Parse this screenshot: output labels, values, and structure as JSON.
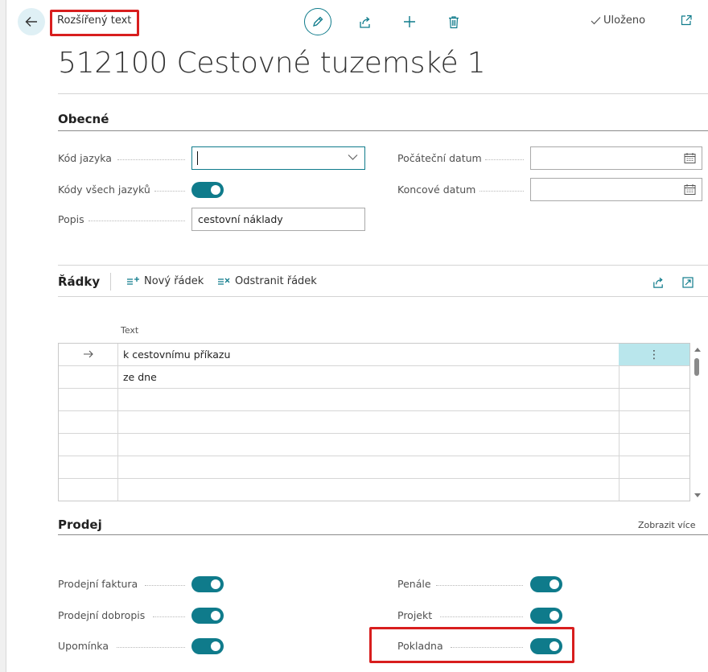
{
  "header": {
    "breadcrumb": "Rozšířený text",
    "status": "Uloženo",
    "title": "512100 Cestovné tuzemské 1"
  },
  "toolbar": {
    "icons": [
      "pencil-icon",
      "share-icon",
      "plus-icon",
      "trash-icon"
    ]
  },
  "general": {
    "section_title": "Obecné",
    "language_code_label": "Kód jazyka",
    "language_code_value": "",
    "all_languages_label": "Kódy všech jazyků",
    "all_languages_on": true,
    "description_label": "Popis",
    "description_value": "cestovní náklady",
    "start_date_label": "Počáteční datum",
    "start_date_value": "",
    "end_date_label": "Koncové datum",
    "end_date_value": ""
  },
  "lines": {
    "section_title": "Řádky",
    "new_line_label": "Nový řádek",
    "delete_line_label": "Odstranit řádek",
    "column_text": "Text",
    "rows": [
      "k cestovnímu příkazu",
      "ze dne",
      "",
      "",
      "",
      "",
      ""
    ]
  },
  "sales": {
    "section_title": "Prodej",
    "show_more": "Zobrazit více",
    "sales_invoice_label": "Prodejní faktura",
    "sales_invoice_on": true,
    "sales_credit_memo_label": "Prodejní dobropis",
    "sales_credit_memo_on": true,
    "reminder_label": "Upomínka",
    "reminder_on": true,
    "penalty_label": "Penále",
    "penalty_on": true,
    "project_label": "Projekt",
    "project_on": true,
    "cash_desk_label": "Pokladna",
    "cash_desk_on": true
  },
  "colors": {
    "accent": "#0f7b8b",
    "highlight_box": "#d81e1e",
    "selected_cell": "#b9e6ec"
  }
}
